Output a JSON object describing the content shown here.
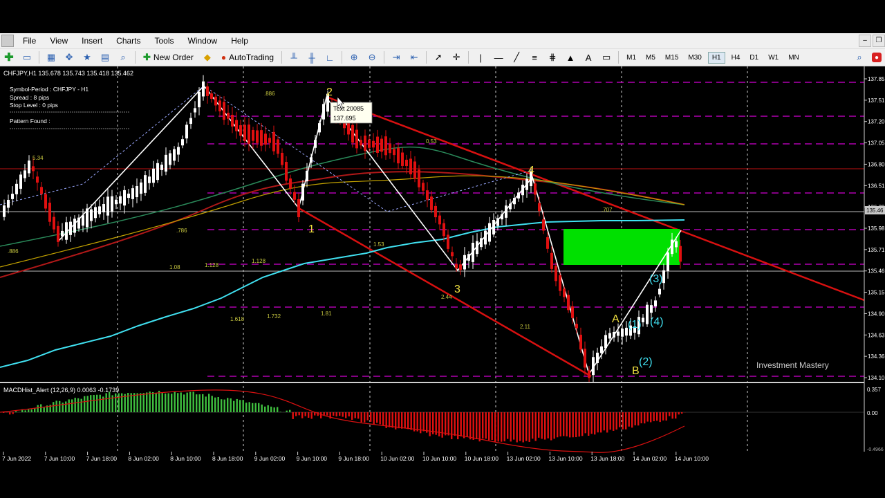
{
  "menu": {
    "items": [
      "File",
      "View",
      "Insert",
      "Charts",
      "Tools",
      "Window",
      "Help"
    ]
  },
  "toolbar": {
    "new_order_label": "New Order",
    "autotrading_label": "AutoTrading",
    "timeframes": [
      "M1",
      "M5",
      "M15",
      "M30",
      "H1",
      "H4",
      "D1",
      "W1",
      "MN"
    ],
    "active_timeframe": "H1"
  },
  "chart": {
    "header": "CHFJPY,H1  135.678 135.743 135.418 135.462",
    "info_panel": {
      "symbol_period": "Symbol-Period : CHFJPY - H1",
      "spread": "Spread         : 8 pips",
      "stop_level": "Stop Level     : 0 pips",
      "pattern_found": "Pattern Found  :"
    },
    "tooltip_line1": "Text 20085",
    "tooltip_line2": "137.695",
    "watermark": "Investment Mastery",
    "price_ticks": [
      "137.85",
      "137.51",
      "137.20",
      "137.05",
      "136.80",
      "136.51",
      "136.20",
      "135.98",
      "135.71",
      "135.46",
      "135.15",
      "134.90",
      "134.63",
      "134.36",
      "134.10"
    ],
    "current_price_label": "135.46",
    "time_ticks": [
      "7 Jun 2022",
      "7 Jun 10:00",
      "7 Jun 18:00",
      "8 Jun 02:00",
      "8 Jun 10:00",
      "8 Jun 18:00",
      "9 Jun 02:00",
      "9 Jun 10:00",
      "9 Jun 18:00",
      "10 Jun 02:00",
      "10 Jun 10:00",
      "10 Jun 18:00",
      "13 Jun 02:00",
      "13 Jun 10:00",
      "13 Jun 18:00",
      "14 Jun 02:00",
      "14 Jun 10:00"
    ],
    "wave_labels": {
      "w1": "1",
      "w2": "2",
      "w3": "3",
      "w4": "4",
      "a": "A",
      "b": "B",
      "c1": "(1)",
      "c2": "(2)",
      "c3": "(3)",
      "c4": "(4)"
    },
    "fib_labels": {
      "f1": "5.34",
      "f2": ".886",
      "f3": ".786",
      "f4": "1.08",
      "f5": "1.128",
      "f6": "1.128",
      "f7": "1.618",
      "f8": "1.732",
      "f9": "1.81",
      "f10": "1.53",
      "f11": "2.44",
      "f12": "2.11",
      "f13": ".886",
      "f14": "0.53",
      "f15": ".707"
    },
    "colors": {
      "bull_candle": "#ffffff",
      "bear_candle": "#e01010",
      "zone_fill": "#00e000",
      "fib_line": "#b000b0",
      "trend_line": "#d81010",
      "step_line": "#40e0f0",
      "wave_label": "#f0e040"
    }
  },
  "indicator": {
    "label": "MACDHist_Alert (12,26,9)  0.0063 -0.1739",
    "ticks": [
      "0.357",
      "0.00",
      "-0.4966"
    ]
  }
}
